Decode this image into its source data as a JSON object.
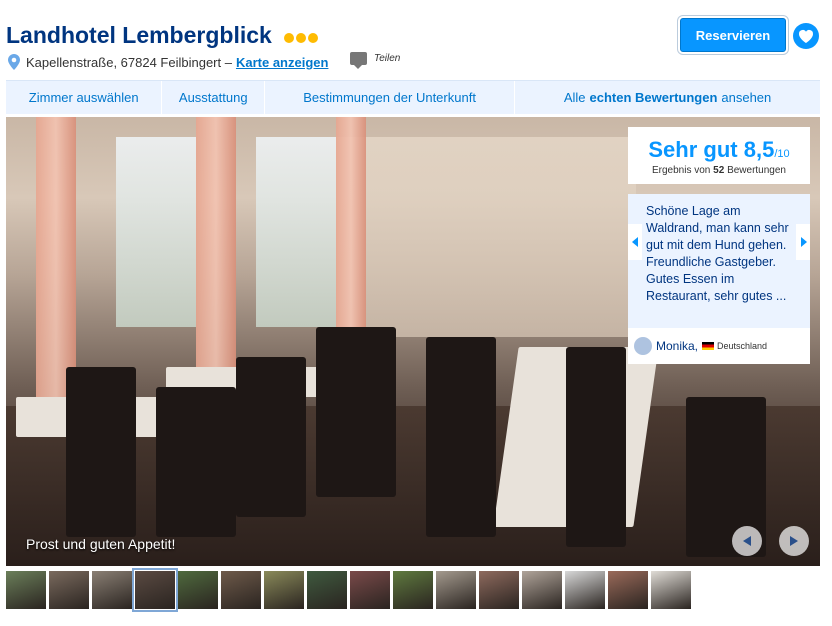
{
  "hotel": {
    "name": "Landhotel Lembergblick",
    "stars": 3,
    "address": "Kapellenstraße, 67824 Feilbingert –",
    "map_link": "Karte anzeigen",
    "share_label": "Teilen"
  },
  "actions": {
    "reserve_label": "Reservieren"
  },
  "nav": {
    "tabs": [
      "Zimmer auswählen",
      "Ausstattung",
      "Bestimmungen der Unterkunft"
    ],
    "reviews_prefix": "Alle",
    "reviews_bold": "echten Bewertungen",
    "reviews_suffix": "ansehen"
  },
  "score": {
    "label": "Sehr gut",
    "value": "8,5",
    "max": "/10",
    "summary_prefix": "Ergebnis von",
    "review_count": "52",
    "summary_suffix": "Bewertungen"
  },
  "review": {
    "text": "Schöne Lage am Waldrand, man kann sehr gut mit dem Hund gehen. Freundliche Gastgeber. Gutes Essen im Restaurant, sehr gutes ...",
    "author": "Monika,",
    "country": "Deutschland"
  },
  "gallery": {
    "caption": "Prost und guten Appetit!",
    "selected_index": 3,
    "thumbnail_colors": [
      "#6b7f5a",
      "#7a6a5e",
      "#8a7f74",
      "#5a4a42",
      "#4f6a3e",
      "#6e5a4a",
      "#8a8a5a",
      "#3f5a3f",
      "#7a4a4a",
      "#5f7a3f",
      "#a49a8e",
      "#8e6a5e",
      "#b0a49a",
      "#d8d8d8",
      "#9a6a5a",
      "#e0dcd6"
    ]
  },
  "colors": {
    "brand_dark": "#003580",
    "accent": "#0896ff",
    "link": "#0077cc",
    "star": "#febb02"
  }
}
